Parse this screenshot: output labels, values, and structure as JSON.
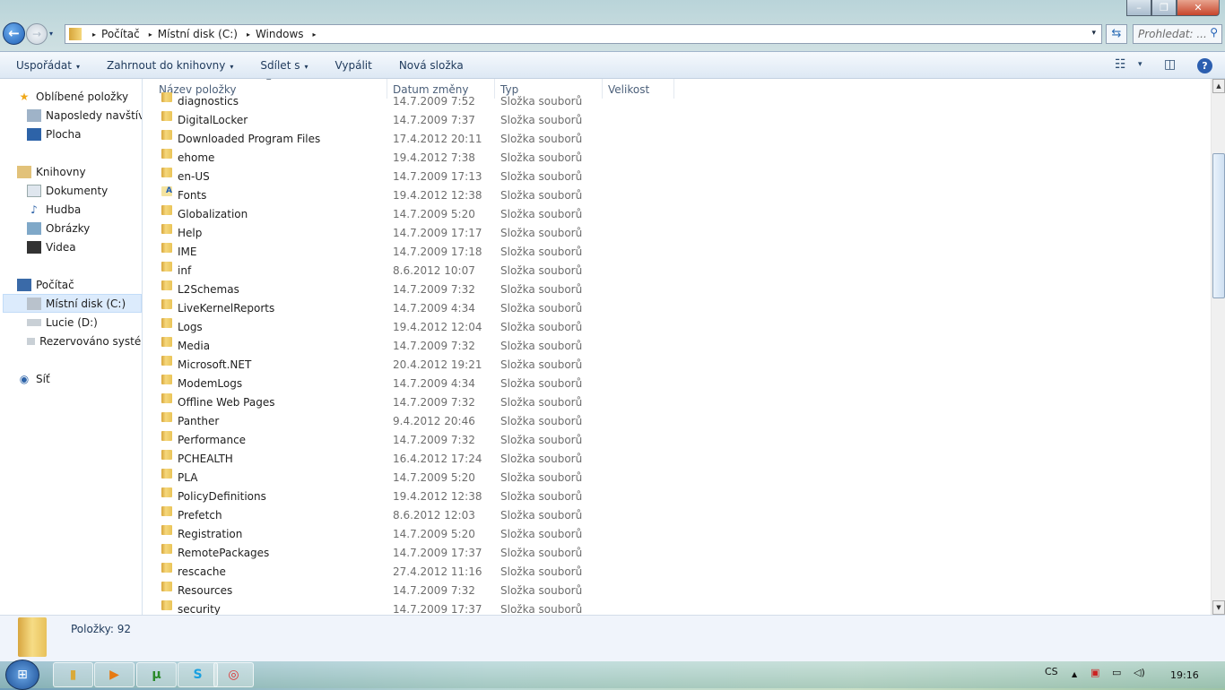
{
  "window": {
    "minimize": "–",
    "maximize": "❐",
    "close": "✕"
  },
  "nav": {
    "back": "←",
    "forward": "→",
    "dropdown": "▾"
  },
  "address": {
    "crumbs": [
      "Počítač",
      "Místní disk (C:)",
      "Windows"
    ],
    "separator": "▸"
  },
  "search": {
    "placeholder": "Prohledat: ...",
    "icon": "⚲"
  },
  "toolbar": {
    "organize": "Uspořádat",
    "include_library": "Zahrnout do knihovny",
    "share": "Sdílet s",
    "burn": "Vypálit",
    "new_folder": "Nová složka",
    "dropdown": "▾",
    "help": "?"
  },
  "sidebar": {
    "favorites": {
      "label": "Oblíbené položky",
      "items": [
        "Naposledy navštívené",
        "Plocha"
      ]
    },
    "libraries": {
      "label": "Knihovny",
      "items": [
        "Dokumenty",
        "Hudba",
        "Obrázky",
        "Videa"
      ]
    },
    "computer": {
      "label": "Počítač",
      "items": [
        "Místní disk (C:)",
        "Lucie (D:)",
        "Rezervováno systémem"
      ]
    },
    "network": {
      "label": "Síť"
    }
  },
  "columns": {
    "name": "Název položky",
    "date": "Datum změny",
    "type": "Typ",
    "size": "Velikost"
  },
  "files": [
    {
      "name": "diagnostics",
      "date": "14.7.2009 7:52",
      "type": "Složka souborů"
    },
    {
      "name": "DigitalLocker",
      "date": "14.7.2009 7:37",
      "type": "Složka souborů"
    },
    {
      "name": "Downloaded Program Files",
      "date": "17.4.2012 20:11",
      "type": "Složka souborů"
    },
    {
      "name": "ehome",
      "date": "19.4.2012 7:38",
      "type": "Složka souborů"
    },
    {
      "name": "en-US",
      "date": "14.7.2009 17:13",
      "type": "Složka souborů"
    },
    {
      "name": "Fonts",
      "date": "19.4.2012 12:38",
      "type": "Složka souborů",
      "icon": "font-folder"
    },
    {
      "name": "Globalization",
      "date": "14.7.2009 5:20",
      "type": "Složka souborů"
    },
    {
      "name": "Help",
      "date": "14.7.2009 17:17",
      "type": "Složka souborů"
    },
    {
      "name": "IME",
      "date": "14.7.2009 17:18",
      "type": "Složka souborů"
    },
    {
      "name": "inf",
      "date": "8.6.2012 10:07",
      "type": "Složka souborů"
    },
    {
      "name": "L2Schemas",
      "date": "14.7.2009 7:32",
      "type": "Složka souborů"
    },
    {
      "name": "LiveKernelReports",
      "date": "14.7.2009 4:34",
      "type": "Složka souborů"
    },
    {
      "name": "Logs",
      "date": "19.4.2012 12:04",
      "type": "Složka souborů"
    },
    {
      "name": "Media",
      "date": "14.7.2009 7:32",
      "type": "Složka souborů"
    },
    {
      "name": "Microsoft.NET",
      "date": "20.4.2012 19:21",
      "type": "Složka souborů"
    },
    {
      "name": "ModemLogs",
      "date": "14.7.2009 4:34",
      "type": "Složka souborů"
    },
    {
      "name": "Offline Web Pages",
      "date": "14.7.2009 7:32",
      "type": "Složka souborů"
    },
    {
      "name": "Panther",
      "date": "9.4.2012 20:46",
      "type": "Složka souborů"
    },
    {
      "name": "Performance",
      "date": "14.7.2009 7:32",
      "type": "Složka souborů"
    },
    {
      "name": "PCHEALTH",
      "date": "16.4.2012 17:24",
      "type": "Složka souborů"
    },
    {
      "name": "PLA",
      "date": "14.7.2009 5:20",
      "type": "Složka souborů"
    },
    {
      "name": "PolicyDefinitions",
      "date": "19.4.2012 12:38",
      "type": "Složka souborů"
    },
    {
      "name": "Prefetch",
      "date": "8.6.2012 12:03",
      "type": "Složka souborů"
    },
    {
      "name": "Registration",
      "date": "14.7.2009 5:20",
      "type": "Složka souborů"
    },
    {
      "name": "RemotePackages",
      "date": "14.7.2009 17:37",
      "type": "Složka souborů"
    },
    {
      "name": "rescache",
      "date": "27.4.2012 11:16",
      "type": "Složka souborů"
    },
    {
      "name": "Resources",
      "date": "14.7.2009 7:32",
      "type": "Složka souborů"
    },
    {
      "name": "security",
      "date": "14.7.2009 17:37",
      "type": "Složka souborů"
    }
  ],
  "status": {
    "items": "Položky: 92"
  },
  "taskbar": {
    "apps": [
      "explorer",
      "media-player",
      "utorrent",
      "skype",
      "chrome"
    ],
    "language": "CS",
    "clock": "19:16"
  },
  "scroll": {
    "position_fraction": 0.15
  }
}
